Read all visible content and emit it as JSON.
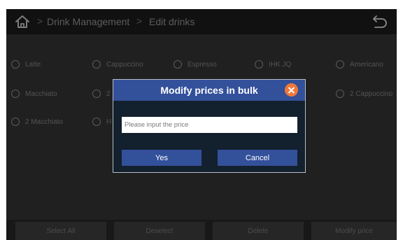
{
  "breadcrumb": {
    "items": [
      "Drink Management",
      "Edit drinks"
    ],
    "separator": ">"
  },
  "drinks": [
    {
      "label": "Latte"
    },
    {
      "label": "Cappuccino"
    },
    {
      "label": "Espresso"
    },
    {
      "label": "IHK JQ"
    },
    {
      "label": "Americano"
    },
    {
      "label": "Macchiato"
    },
    {
      "label": "2"
    },
    {
      "label": "2 Cappuccino"
    },
    {
      "label": "2 Macchiato"
    },
    {
      "label": "H"
    }
  ],
  "bottom_bar": {
    "select_all": "Select All",
    "deselect": "Deselect",
    "delete": "Delete",
    "modify_price": "Modify price"
  },
  "modal": {
    "title": "Modify prices in bulk",
    "input_placeholder": "Please input the price",
    "input_value": "",
    "yes_label": "Yes",
    "cancel_label": "Cancel"
  },
  "colors": {
    "accent": "#33509b",
    "close_button": "#f0783a",
    "screen_background": "#1b1b1b"
  }
}
